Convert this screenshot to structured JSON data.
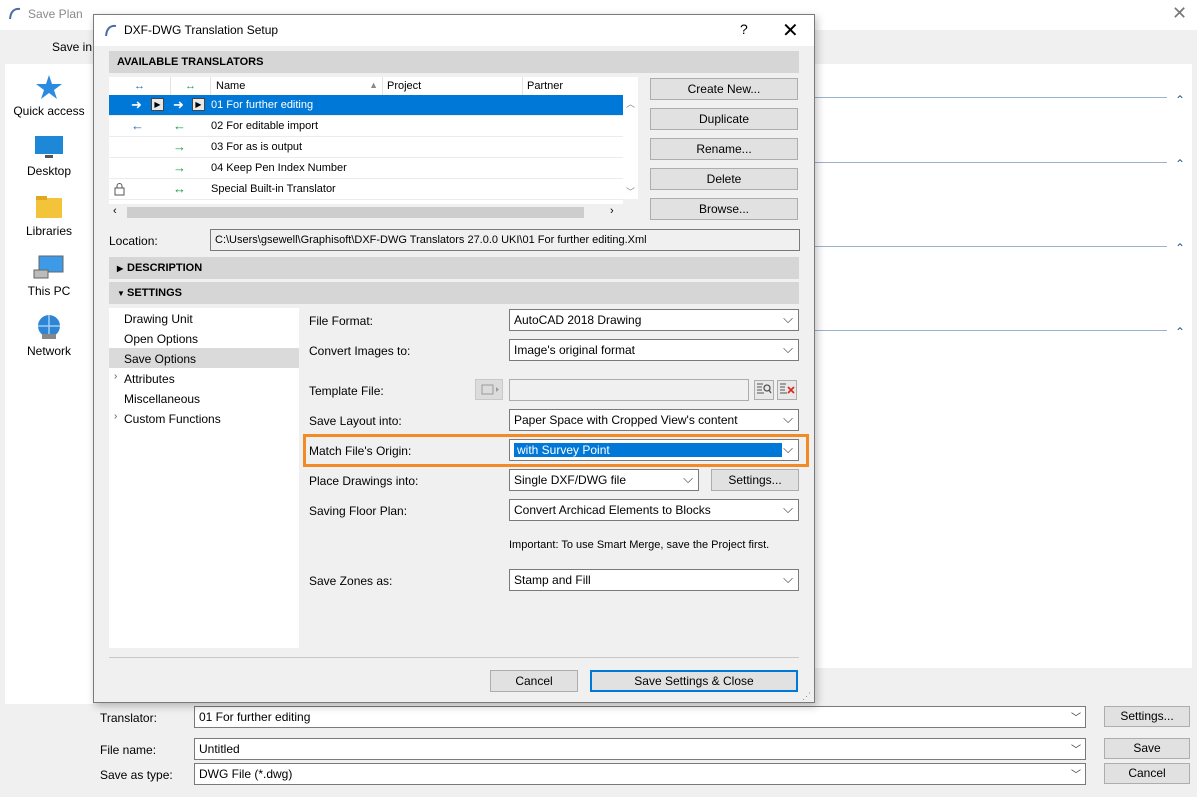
{
  "background_window": {
    "title": "Save Plan",
    "save_in_label": "Save in:",
    "places": [
      "Quick access",
      "Desktop",
      "Libraries",
      "This PC",
      "Network"
    ],
    "translator_label": "Translator:",
    "translator_value": "01 For further editing",
    "filename_label": "File name:",
    "filename_value": "Untitled",
    "saveastype_label": "Save as type:",
    "saveastype_value": "DWG File (*.dwg)",
    "settings_button": "Settings...",
    "save_button": "Save",
    "cancel_button": "Cancel"
  },
  "dialog": {
    "title": "DXF-DWG Translation Setup",
    "help": "?",
    "close": "✕",
    "available_header": "AVAILABLE TRANSLATORS",
    "columns": {
      "name": "Name",
      "project": "Project",
      "partner": "Partner"
    },
    "translators": [
      "01 For further editing",
      "02 For editable import",
      "03 For as is output",
      "04 Keep Pen Index Number",
      "Special Built-in Translator"
    ],
    "buttons": {
      "create_new": "Create New...",
      "duplicate": "Duplicate",
      "rename": "Rename...",
      "delete": "Delete",
      "browse": "Browse..."
    },
    "location_label": "Location:",
    "location_value": "C:\\Users\\gsewell\\Graphisoft\\DXF-DWG Translators 27.0.0 UKI\\01 For further editing.Xml",
    "description_header": "DESCRIPTION",
    "settings_header": "SETTINGS",
    "nav": [
      "Drawing Unit",
      "Open Options",
      "Save Options",
      "Attributes",
      "Miscellaneous",
      "Custom Functions"
    ],
    "fields": {
      "file_format_label": "File Format:",
      "file_format_value": "AutoCAD 2018 Drawing",
      "convert_images_label": "Convert Images to:",
      "convert_images_value": "Image's original format",
      "template_file_label": "Template File:",
      "save_layout_label": "Save Layout into:",
      "save_layout_value": "Paper Space with Cropped View's content",
      "match_origin_label": "Match File's Origin:",
      "match_origin_value": "with Survey Point",
      "place_drawings_label": "Place Drawings into:",
      "place_drawings_value": "Single DXF/DWG file",
      "place_settings_button": "Settings...",
      "saving_floor_plan_label": "Saving Floor Plan:",
      "saving_floor_plan_value": "Convert Archicad Elements to Blocks",
      "important_note": "Important: To use Smart Merge, save the Project first.",
      "save_zones_label": "Save Zones as:",
      "save_zones_value": "Stamp and Fill"
    },
    "cancel_button": "Cancel",
    "save_close_button": "Save Settings & Close"
  },
  "colors": {
    "selection": "#0078d7",
    "highlight_box": "#f28a26",
    "arrow_green": "#1c9e4a"
  }
}
